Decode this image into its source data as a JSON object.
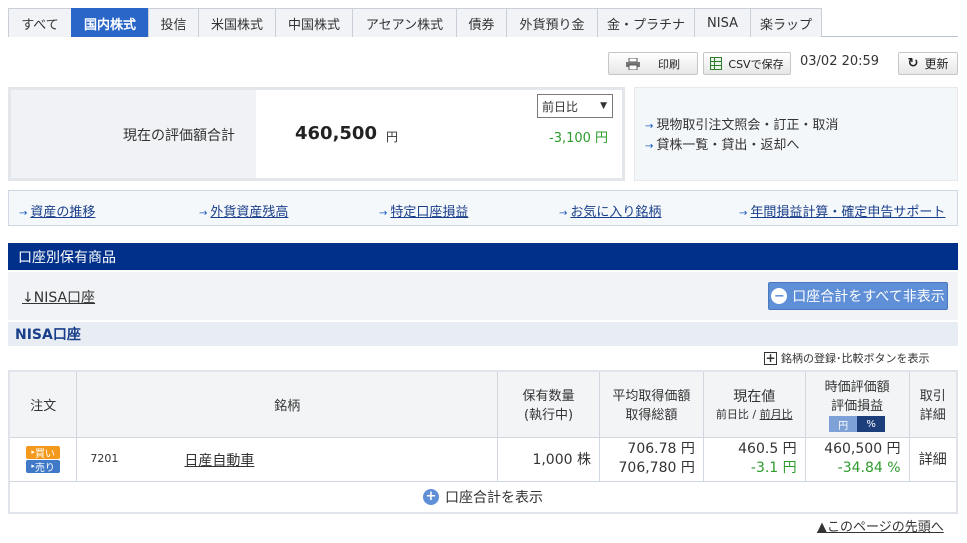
{
  "tabs": [
    "すべて",
    "国内株式",
    "投信",
    "米国株式",
    "中国株式",
    "アセアン株式",
    "債券",
    "外貨預り金",
    "金・プラチナ",
    "NISA",
    "楽ラップ"
  ],
  "active_tab": "国内株式",
  "toolbar": {
    "print_label": "印刷",
    "csv_label": "CSVで保存",
    "timestamp": "03/02 20:59",
    "refresh_label": "更新"
  },
  "summary": {
    "label": "現在の評価額合計",
    "value": "460,500",
    "unit": "円",
    "compare_select": "前日比",
    "change": "-3,100 円",
    "links": [
      "現物取引注文照会・訂正・取消",
      "貸株一覧・貸出・返却へ"
    ]
  },
  "nav_links": [
    "資産の推移",
    "外貨資産残高",
    "特定口座損益",
    "お気に入り銘柄",
    "年間損益計算・確定申告サポート"
  ],
  "section_title": "口座別保有商品",
  "account_link": "↓NISA口座",
  "hide_all_label": "口座合計をすべて非表示",
  "nisa_title": "NISA口座",
  "register_label": "銘柄の登録･比較ボタンを表示",
  "table": {
    "headers": {
      "order": "注文",
      "name": "銘柄",
      "qty1": "保有数量",
      "qty2": "(執行中)",
      "avg1": "平均取得価額",
      "avg2": "取得総額",
      "cur1": "現在値",
      "cur2a": "前日比",
      "cur2sep": " / ",
      "cur2b": "前月比",
      "val1": "時価評価額",
      "val2": "評価損益",
      "toggle_yen": "円",
      "toggle_pct": "%",
      "detail1": "取引",
      "detail2": "詳細"
    },
    "row": {
      "buy": "買い",
      "sell": "売り",
      "code": "7201",
      "name": "日産自動車",
      "qty": "1,000 株",
      "avg_price": "706.78 円",
      "avg_total": "706,780 円",
      "cur_price": "460.5 円",
      "cur_change": "-3.1 円",
      "value": "460,500 円",
      "pnl": "-34.84 %",
      "detail": "詳細"
    },
    "show_total_label": "口座合計を表示"
  },
  "page_top_label": "▲このページの先頭へ"
}
